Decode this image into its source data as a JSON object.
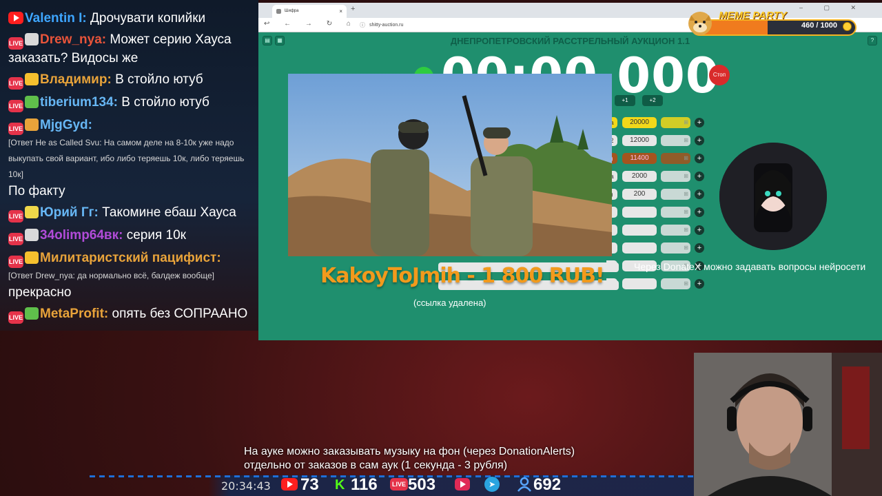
{
  "chat": {
    "messages": [
      {
        "platform": "youtube",
        "nick": "Valentin I:",
        "nick_color": "#3ea6ff",
        "text": "Дрочувати копийки"
      },
      {
        "platform": "live",
        "nick": "Drew_nya:",
        "nick_color": "#e8543a",
        "text": "Может серию Хауса заказать? Видосы же"
      },
      {
        "platform": "live",
        "nick": "Владимир:",
        "nick_color": "#e8a33a",
        "text": "В стойло ютуб"
      },
      {
        "platform": "live",
        "nick": "tiberium134:",
        "nick_color": "#67b7f5",
        "text": "В стойло ютуб"
      },
      {
        "platform": "live",
        "nick": "MjgGyd:",
        "nick_color": "#67b7f5",
        "reply": "[Ответ He as Called Svu: На самом деле на 8-10к уже надо выкупать свой вариант, ибо либо теряешь 10к, либо теряешь 10к]",
        "text": "По факту"
      },
      {
        "platform": "live",
        "nick": "Юрий Гг:",
        "nick_color": "#67b7f5",
        "text": "Такомине ебаш Хауса"
      },
      {
        "platform": "live",
        "nick": "34olimp64вк:",
        "nick_color": "#b14bd8",
        "text": "серия 10к"
      },
      {
        "platform": "live",
        "nick": "Милитаристский пацифист:",
        "nick_color": "#e8a33a",
        "reply": "[Ответ Drew_nya: да нормально всё, балдеж вообще]",
        "text": "прекрасно"
      },
      {
        "platform": "live",
        "nick": "MetaProfit:",
        "nick_color": "#e8a33a",
        "text": "опять без СОПРААНО"
      }
    ]
  },
  "browser": {
    "tab_title": "Шифра",
    "url": "shitty-auction.ru",
    "new_tab": "+",
    "window_controls": "– ▢ ✕"
  },
  "auction": {
    "title": "ДНЕПРОПЕТРОВСКИЙ РАССТРЕЛЬНЫЙ АУКЦИОН 1.1",
    "timer": "00:00.000",
    "stop_label": "Стоп",
    "time_buttons": [
      "+1",
      "+2"
    ],
    "lots": [
      {
        "name": "a",
        "value": "20000",
        "style": "gold"
      },
      {
        "name": "2",
        "value": "12000",
        "style": "normal"
      },
      {
        "name": ")",
        "value": "11400",
        "style": "brown"
      },
      {
        "name": "a",
        "value": "2000",
        "style": "normal"
      },
      {
        "name": ")",
        "value": "200",
        "style": "normal"
      },
      {
        "name": "",
        "value": "",
        "style": "normal"
      },
      {
        "name": "",
        "value": "",
        "style": "normal"
      },
      {
        "name": "",
        "value": "",
        "style": "normal"
      },
      {
        "name": "",
        "value": "",
        "style": "normal"
      },
      {
        "name": "",
        "value": "",
        "style": "normal"
      }
    ],
    "plus_label": "+"
  },
  "overlay": {
    "donation": "KakoyToJmih - 1 800 RUB!",
    "removed_link": "(ссылка удалена)",
    "ai_caption": "Через DonateX можно задавать вопросы нейросети",
    "subtitle_line1": "На ауке можно заказывать музыку на фон (через DonationAlerts)",
    "subtitle_line2": "отдельно от заказов в сам аук (1 секунда - 3 рубля)"
  },
  "meme_party": {
    "title": "MEME PARTY",
    "count": "460 / 1000",
    "progress": 0.46,
    "accent": "#f5b321"
  },
  "status_bar": {
    "clock": "20:34:43",
    "youtube": "73",
    "kick": "116",
    "live": "503",
    "users": "692",
    "live_label": "LIVE",
    "kick_label": "K"
  }
}
